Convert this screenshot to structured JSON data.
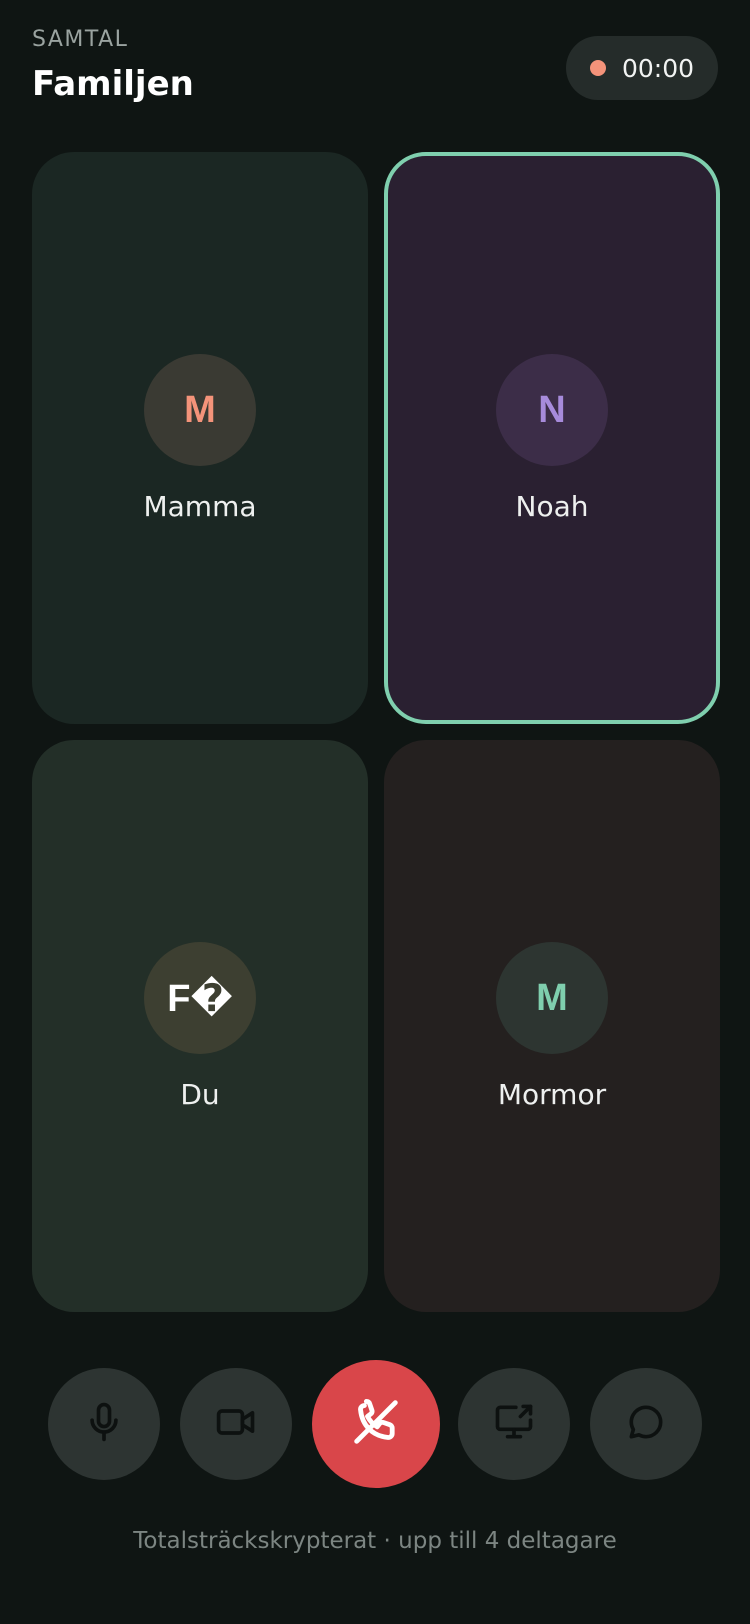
{
  "header": {
    "eyebrow": "SAMTAL",
    "title": "Familjen",
    "timer": "00:00"
  },
  "participants": [
    {
      "initials": "M",
      "name": "Mamma",
      "tile_color": "#1b2723",
      "avatar_bg": "#3a3a33",
      "initial_color": "#f4937a",
      "speaking": false
    },
    {
      "initials": "N",
      "name": "Noah",
      "tile_color": "#2a2031",
      "avatar_bg": "#3c2d48",
      "initial_color": "#a78bdb",
      "speaking": true,
      "highlight_color": "#7fcfae"
    },
    {
      "initials": "F�",
      "name": "Du",
      "tile_color": "#232f28",
      "avatar_bg": "#3d3f31",
      "initial_color": "#ffffff",
      "speaking": false
    },
    {
      "initials": "M",
      "name": "Mormor",
      "tile_color": "#24201f",
      "avatar_bg": "#2d3531",
      "initial_color": "#7fcfae",
      "speaking": false
    }
  ],
  "controls": {
    "mic_icon": "microphone-icon",
    "camera_icon": "video-camera-icon",
    "end_call_icon": "phone-hangup-icon",
    "share_screen_icon": "screen-share-icon",
    "chat_icon": "chat-bubble-icon",
    "end_call_color": "#d9464a"
  },
  "footer": {
    "text": "Totalsträckskrypterat · upp till 4 deltagare"
  },
  "colors": {
    "background": "#0f1513",
    "recording_dot": "#f4937a",
    "control_bg": "#2d3432"
  }
}
